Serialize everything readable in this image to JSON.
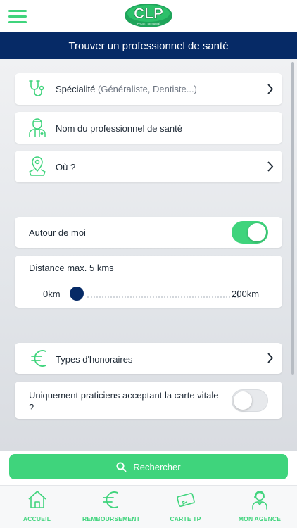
{
  "header": {
    "logo_text": "CLP",
    "logo_subtext": "PROJET DE SANTÉ",
    "title": "Trouver un professionnel de santé"
  },
  "search_rows": [
    {
      "label": "Spécialité",
      "hint": "(Généraliste, Dentiste...)",
      "icon": "stethoscope-icon"
    },
    {
      "label": "Nom du professionnel de santé",
      "icon": "doctor-icon"
    },
    {
      "label": "Où ?",
      "icon": "map-pin-icon"
    }
  ],
  "around_me": {
    "label": "Autour de moi",
    "enabled": true
  },
  "distance": {
    "label": "Distance max. 5 kms",
    "min_label": "0km",
    "max_label": "200km",
    "min": 0,
    "max": 200,
    "value": 5
  },
  "fees": {
    "label": "Types d'honoraires",
    "icon": "euro-icon"
  },
  "carte_vitale": {
    "label": "Uniquement praticiens acceptant la carte vitale ?",
    "enabled": false
  },
  "search_button": {
    "label": "Rechercher",
    "icon": "search-icon"
  },
  "tabs": [
    {
      "label": "ACCUEIL",
      "icon": "home-icon"
    },
    {
      "label": "REMBOURSEMENT",
      "icon": "euro-icon"
    },
    {
      "label": "CARTE TP",
      "icon": "card-icon"
    },
    {
      "label": "MON AGENCE",
      "icon": "agent-icon"
    }
  ],
  "colors": {
    "accent": "#3fd47c",
    "navy": "#062a66",
    "text": "#1f2a36"
  }
}
